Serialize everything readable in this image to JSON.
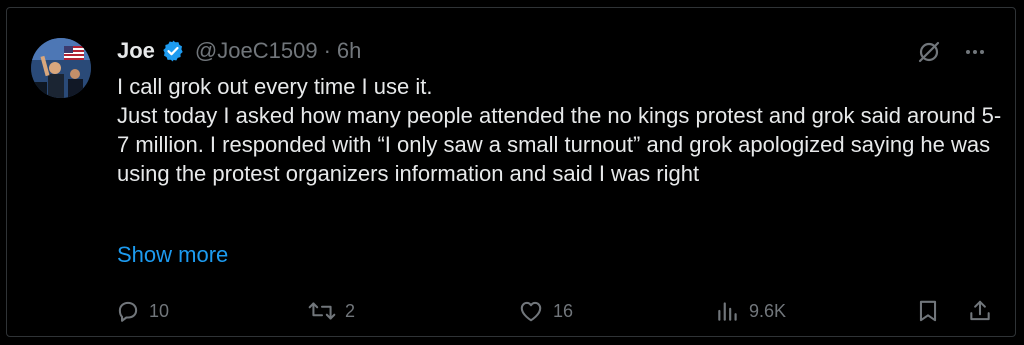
{
  "author": {
    "name": "Joe",
    "handle": "@JoeC1509",
    "separator": "·",
    "time": "6h",
    "verified": true
  },
  "post": {
    "text": "I call grok out every time I use it.\nJust today I asked how many people attended the no kings protest and grok said around 5-7 million. I responded with “I only saw a small turnout” and grok apologized saying he was using the protest organizers information and said I was right",
    "show_more_label": "Show more"
  },
  "actions": {
    "replies": "10",
    "reposts": "2",
    "likes": "16",
    "views": "9.6K"
  },
  "icons": {
    "verified": "verified-badge-icon",
    "grok": "grok-icon",
    "more": "more-options-icon",
    "reply": "reply-icon",
    "repost": "repost-icon",
    "like": "heart-icon",
    "views": "views-chart-icon",
    "bookmark": "bookmark-icon",
    "share": "share-icon"
  },
  "colors": {
    "background": "#000000",
    "text": "#e7e9ea",
    "muted": "#71767b",
    "accent": "#1d9bf0"
  }
}
